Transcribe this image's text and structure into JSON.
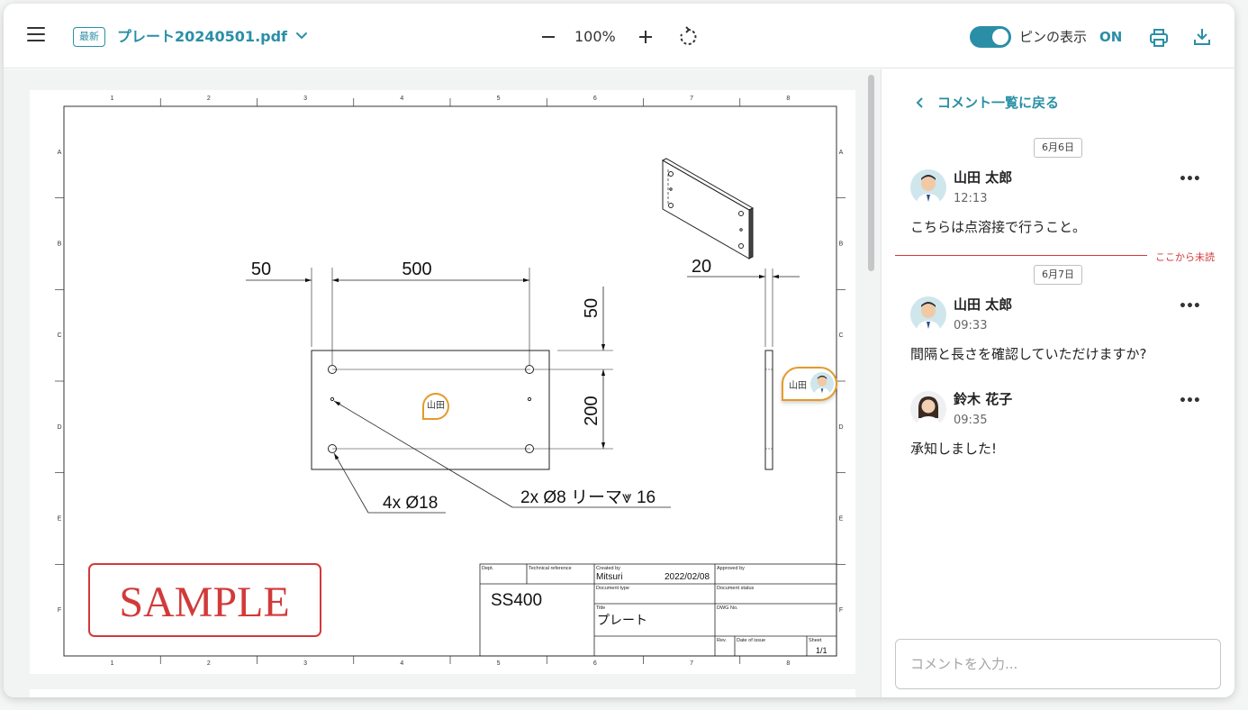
{
  "colors": {
    "accent": "#2a8fa6",
    "pin_border": "#e49a2a",
    "unread": "#d23a3a",
    "stamp": "#d23a3a"
  },
  "toolbar": {
    "menu_icon": "hamburger-icon",
    "latest_badge": "最新",
    "file_name": "プレート20240501.pdf",
    "zoom_out_icon": "minus-icon",
    "zoom_level": "100%",
    "zoom_in_icon": "plus-icon",
    "rotate_icon": "rotate-icon",
    "pin_toggle_label": "ピンの表示",
    "pin_toggle_state": "ON",
    "print_icon": "printer-icon",
    "download_icon": "download-icon"
  },
  "drawing": {
    "column_labels": [
      "1",
      "2",
      "3",
      "4",
      "5",
      "6",
      "7",
      "8"
    ],
    "row_labels": [
      "A",
      "B",
      "C",
      "D",
      "E",
      "F"
    ],
    "dim_50_left": "50",
    "dim_500": "500",
    "dim_20": "20",
    "dim_50_right": "50",
    "dim_200": "200",
    "note_holes": "4x Ø18",
    "note_reamer": "2x Ø8 リーマ⩔ 16",
    "stamp": "SAMPLE",
    "title_block": {
      "dept": "Dept.",
      "technical_reference": "Technical reference",
      "created_by_label": "Created by",
      "created_by": "Mitsuri",
      "created_date": "2022/02/08",
      "approved_by": "Approved by",
      "material": "SS400",
      "document_type": "Document type",
      "document_status": "Document status",
      "title_label": "Title",
      "title": "プレート",
      "dwg_no": "DWG No.",
      "rev": "Rev.",
      "date_of_issue": "Date of issue",
      "sheet_label": "Sheet",
      "sheet": "1/1"
    }
  },
  "pins": [
    {
      "label": "山田"
    },
    {
      "label": "山田"
    }
  ],
  "sidebar": {
    "back_label": "コメント一覧に戻る",
    "unread_marker": "ここから未読",
    "comment_placeholder": "コメントを入力..."
  },
  "comments": [
    {
      "date": "6月6日",
      "author": "山田 太郎",
      "time": "12:13",
      "body": "こちらは点溶接で行うこと。"
    },
    {
      "date": "6月7日",
      "author": "山田 太郎",
      "time": "09:33",
      "body": "間隔と長さを確認していただけますか?"
    },
    {
      "author": "鈴木 花子",
      "time": "09:35",
      "body": "承知しました!"
    }
  ]
}
